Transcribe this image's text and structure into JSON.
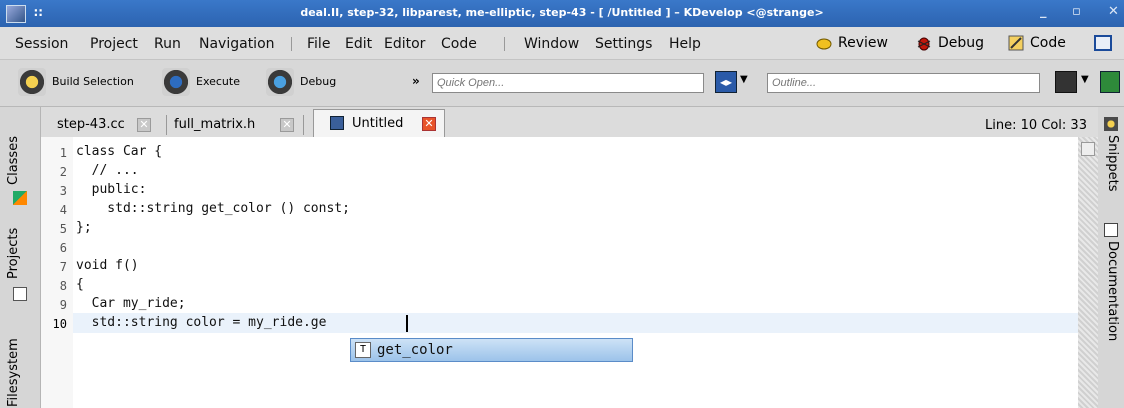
{
  "window": {
    "title": "deal.II, step-32, libparest, me-elliptic, step-43 - [ /Untitled ] – KDevelop <@strange>",
    "controls": [
      "_",
      "▫",
      "✕"
    ]
  },
  "menu": {
    "items": [
      "Session",
      "Project",
      "Run",
      "Navigation",
      "File",
      "Edit",
      "Editor",
      "Code",
      "Window",
      "Settings",
      "Help"
    ],
    "areas": [
      "Review",
      "Debug",
      "Code"
    ]
  },
  "toolbar": {
    "build_selection": "Build Selection",
    "execute": "Execute",
    "debug": "Debug",
    "overflow": "»",
    "quick_open_placeholder": "Quick Open...",
    "outline_placeholder": "Outline..."
  },
  "left_dock": [
    "Classes",
    "Projects",
    "Filesystem"
  ],
  "right_dock": [
    "Snippets",
    "Documentation"
  ],
  "tabs": [
    {
      "label": "step-43.cc",
      "active": false
    },
    {
      "label": "full_matrix.h",
      "active": false
    },
    {
      "label": "Untitled",
      "active": true
    }
  ],
  "status": {
    "position": "Line: 10 Col: 33"
  },
  "editor": {
    "lines": [
      {
        "n": "1",
        "text": "class Car {"
      },
      {
        "n": "2",
        "text": "  // ..."
      },
      {
        "n": "3",
        "text": "  public:"
      },
      {
        "n": "4",
        "text": "    std::string get_color () const;"
      },
      {
        "n": "5",
        "text": "};"
      },
      {
        "n": "6",
        "text": ""
      },
      {
        "n": "7",
        "text": "void f()"
      },
      {
        "n": "8",
        "text": "{"
      },
      {
        "n": "9",
        "text": "  Car my_ride;"
      },
      {
        "n": "10",
        "text": "  std::string color = my_ride.ge"
      }
    ],
    "current_line": 10
  },
  "completion": {
    "icon": "T",
    "item": "get_color"
  },
  "colors": {
    "titlebar": "#2c63b0",
    "current_line": "#eaf2fb",
    "completion_bg": "#9cc3ea",
    "close_active": "#e8542a"
  }
}
